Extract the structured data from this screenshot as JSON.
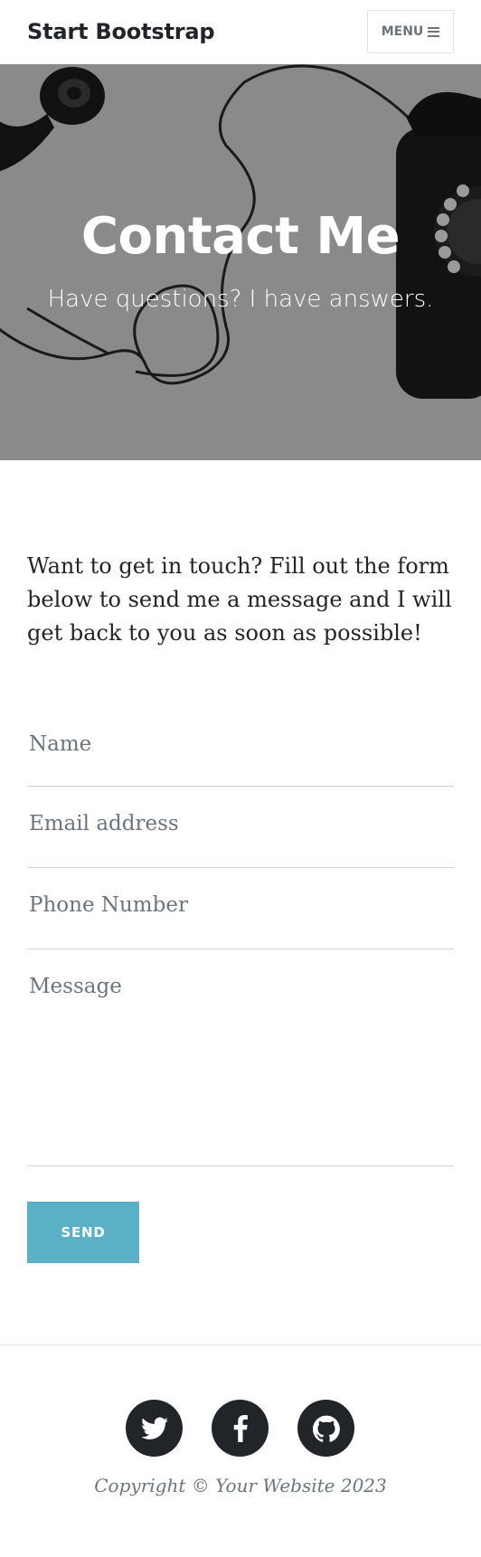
{
  "navbar": {
    "brand": "Start Bootstrap",
    "menu_label": "MENU"
  },
  "hero": {
    "title": "Contact Me",
    "subtitle": "Have questions? I have answers."
  },
  "intro": {
    "text": "Want to get in touch? Fill out the form below to send me a message and I will get back to you as soon as possible!"
  },
  "form": {
    "name_placeholder": "Name",
    "email_placeholder": "Email address",
    "phone_placeholder": "Phone Number",
    "message_placeholder": "Message",
    "name_value": "",
    "email_value": "",
    "phone_value": "",
    "message_value": "",
    "send_label": "SEND",
    "send_color": "#5ab0c4"
  },
  "footer": {
    "social": [
      {
        "icon": "twitter-icon"
      },
      {
        "icon": "facebook-icon"
      },
      {
        "icon": "github-icon"
      }
    ],
    "copyright": "Copyright © Your Website 2023"
  }
}
